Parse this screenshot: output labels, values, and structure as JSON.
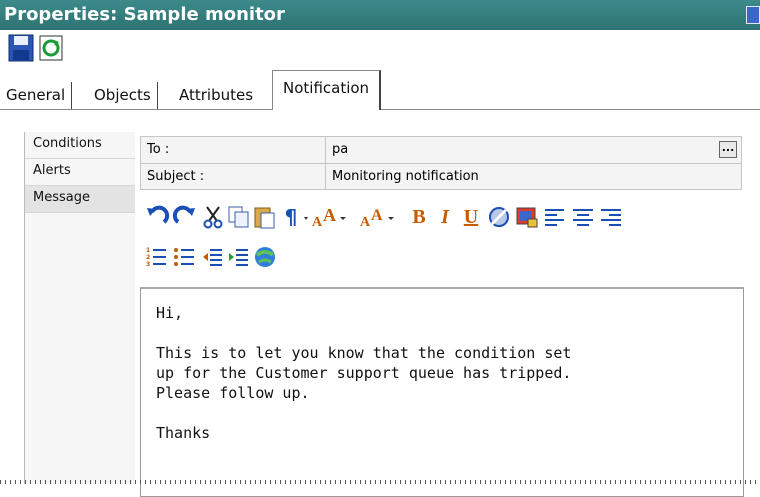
{
  "window": {
    "title": "Properties: Sample monitor"
  },
  "toolbar": {
    "save_icon": "save-icon",
    "refresh_icon": "refresh-icon"
  },
  "tabs": [
    {
      "label": "General"
    },
    {
      "label": "Objects"
    },
    {
      "label": "Attributes"
    },
    {
      "label": "Notification",
      "active": true
    }
  ],
  "sidebar": {
    "items": [
      {
        "label": "Conditions"
      },
      {
        "label": "Alerts"
      },
      {
        "label": "Message",
        "selected": true
      }
    ]
  },
  "form": {
    "to_label": "To :",
    "to_value": "pa",
    "browse_label": "...",
    "subject_label": "Subject :",
    "subject_value": "Monitoring notification"
  },
  "editor_toolbar": {
    "buttons": [
      "undo-icon",
      "redo-icon",
      "cut-icon",
      "copy-icon",
      "paste-icon",
      "paragraph-icon",
      "font-size-increase-icon",
      "font-size-decrease-icon",
      "bold-icon",
      "italic-icon",
      "underline-icon",
      "image-icon",
      "table-icon",
      "align-left-icon",
      "align-center-icon",
      "align-right-icon",
      "numbered-list-icon",
      "bulleted-list-icon",
      "outdent-icon",
      "indent-icon",
      "link-icon"
    ],
    "paragraph_glyph": "¶",
    "bold_glyph": "B",
    "italic_glyph": "I",
    "underline_glyph": "U"
  },
  "message": {
    "body": "Hi,\n\nThis is to let you know that the condition set\nup for the Customer support queue has tripped.\nPlease follow up.\n\nThanks"
  },
  "colors": {
    "titlebar": "#2e7373",
    "accent_blue": "#1a4fb5",
    "bold_orange": "#c65a00"
  }
}
